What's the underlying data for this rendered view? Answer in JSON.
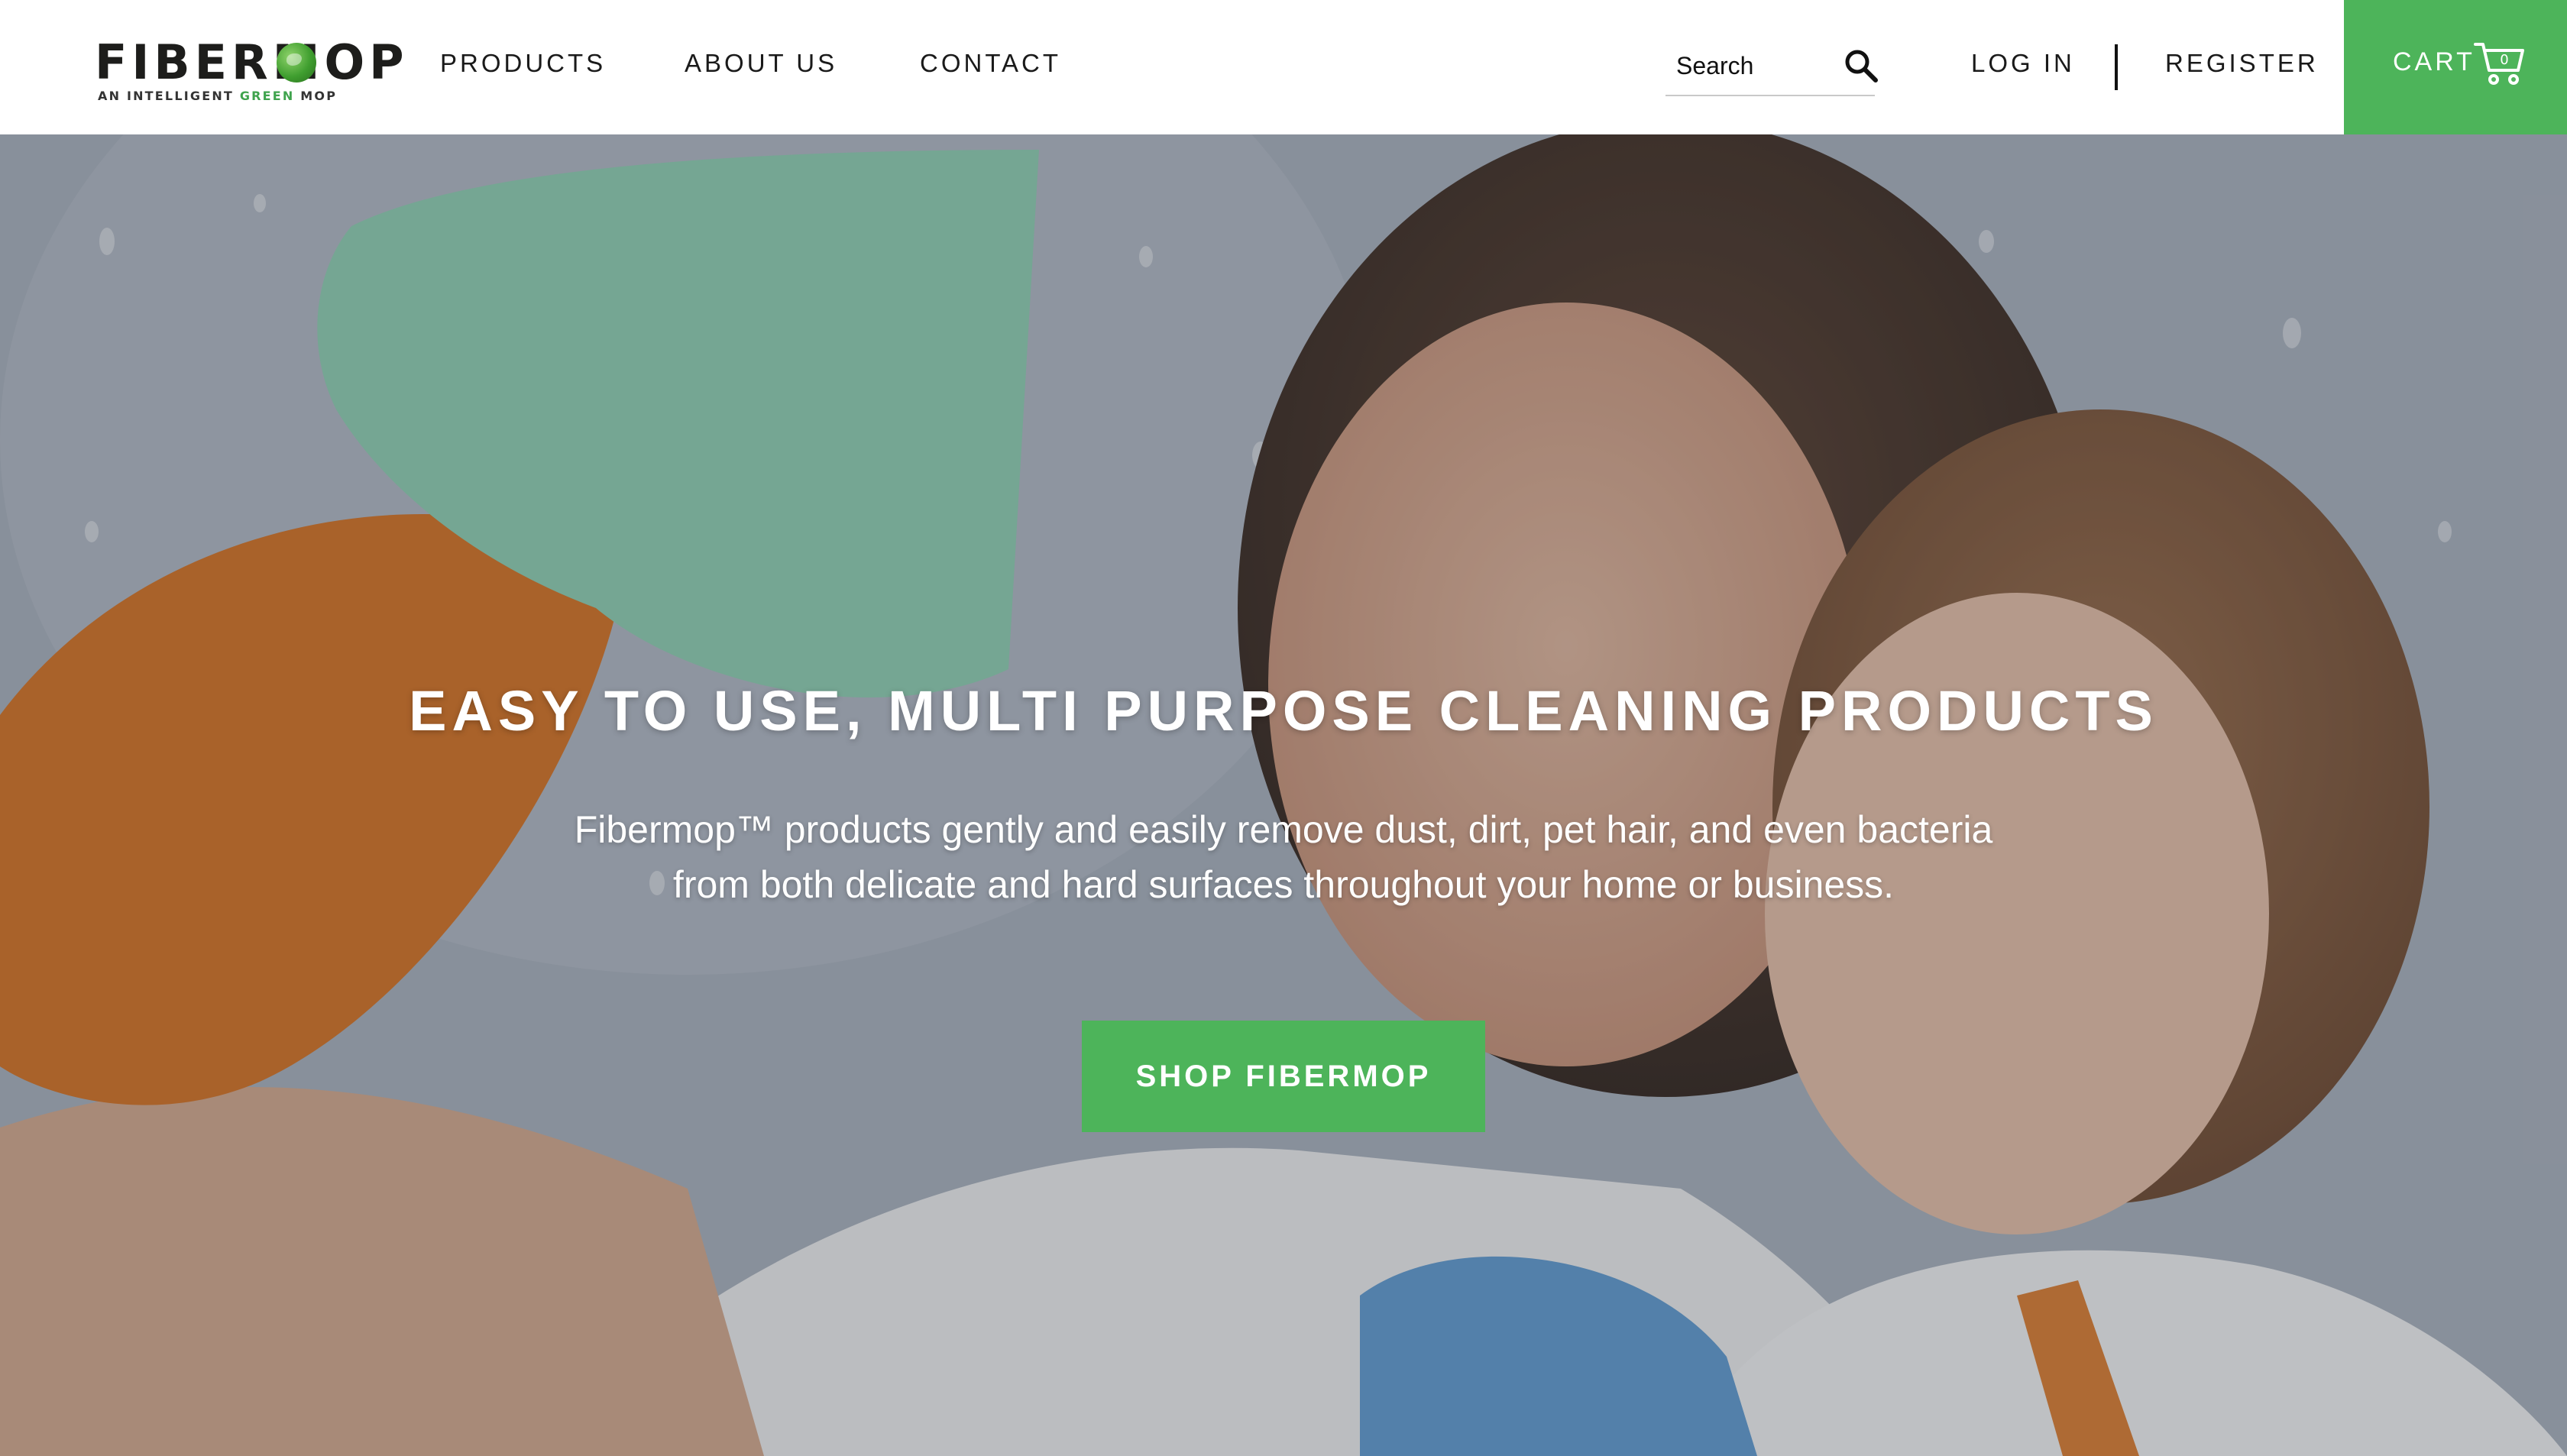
{
  "brand": {
    "logo_text": "FIBERMOP",
    "tagline_prefix": "AN INTELLIGENT ",
    "tagline_green": "GREEN",
    "tagline_suffix": " MOP",
    "green_color": "#4db45a"
  },
  "nav": {
    "items": [
      {
        "label": "PRODUCTS"
      },
      {
        "label": "ABOUT US"
      },
      {
        "label": "CONTACT"
      }
    ]
  },
  "search": {
    "placeholder": "Search",
    "icon": "search-icon"
  },
  "account": {
    "login_label": "LOG IN",
    "register_label": "REGISTER"
  },
  "cart": {
    "label": "CART",
    "icon": "shopping-cart-icon"
  },
  "hero": {
    "title": "EASY TO USE, MULTI PURPOSE CLEANING PRODUCTS",
    "text": "Fibermop™ products gently and easily remove dust, dirt, pet hair, and even bacteria from both delicate and hard surfaces throughout your home or business.",
    "button_label": "SHOP FIBERMOP"
  }
}
